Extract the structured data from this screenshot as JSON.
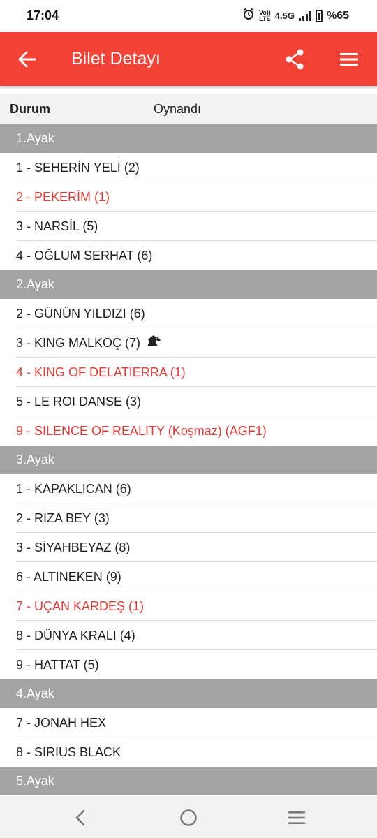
{
  "status_bar": {
    "time": "17:04",
    "network_top": "Vo))",
    "network_bottom": "LTE",
    "network_type": "4.5G",
    "battery": "%65",
    "battery_level": 0.65,
    "icons": [
      "alarm-icon",
      "signal-icon",
      "battery-icon"
    ]
  },
  "app_bar": {
    "title": "Bilet Detayı",
    "background": "#f44336",
    "icons": [
      "back-arrow-icon",
      "share-icon",
      "hamburger-menu-icon"
    ]
  },
  "durum": {
    "label": "Durum",
    "value": "Oynandı"
  },
  "legs": [
    {
      "title": "1.Ayak",
      "horses": [
        {
          "text": "1 - SEHERİN YELİ (2)",
          "highlight": false
        },
        {
          "text": "2 - PEKERİM (1)",
          "highlight": true
        },
        {
          "text": "3 - NARSİL (5)",
          "highlight": false
        },
        {
          "text": "4 - OĞLUM SERHAT (6)",
          "highlight": false
        }
      ]
    },
    {
      "title": "2.Ayak",
      "horses": [
        {
          "text": "2 - GÜNÜN YILDIZI (6)",
          "highlight": false
        },
        {
          "text": "3 - KING MALKOÇ (7)",
          "highlight": false,
          "icon": "horse-head-icon"
        },
        {
          "text": "4 - KING OF DELATIERRA (1)",
          "highlight": true
        },
        {
          "text": "5 - LE ROI DANSE (3)",
          "highlight": false
        },
        {
          "text": "9 - SILENCE OF REALITY (Koşmaz) (AGF1)",
          "highlight": true
        }
      ]
    },
    {
      "title": "3.Ayak",
      "horses": [
        {
          "text": "1 - KAPAKLICAN (6)",
          "highlight": false
        },
        {
          "text": "2 - RIZA BEY (3)",
          "highlight": false
        },
        {
          "text": "3 - SİYAHBEYAZ (8)",
          "highlight": false
        },
        {
          "text": "6 - ALTINEKEN (9)",
          "highlight": false
        },
        {
          "text": "7 - UÇAN KARDEŞ (1)",
          "highlight": true
        },
        {
          "text": "8 - DÜNYA KRALI (4)",
          "highlight": false
        },
        {
          "text": "9 - HATTAT (5)",
          "highlight": false
        }
      ]
    },
    {
      "title": "4.Ayak",
      "horses": [
        {
          "text": "7 - JONAH HEX",
          "highlight": false
        },
        {
          "text": "8 - SIRIUS BLACK",
          "highlight": false
        }
      ]
    },
    {
      "title": "5.Ayak",
      "horses": []
    }
  ],
  "colors": {
    "accent": "#f44336",
    "highlight_text": "#e53935",
    "leg_header_bg": "#a3a3a3"
  },
  "nav_bar": {
    "icons": [
      "nav-back-icon",
      "nav-home-icon",
      "nav-recents-icon"
    ]
  }
}
